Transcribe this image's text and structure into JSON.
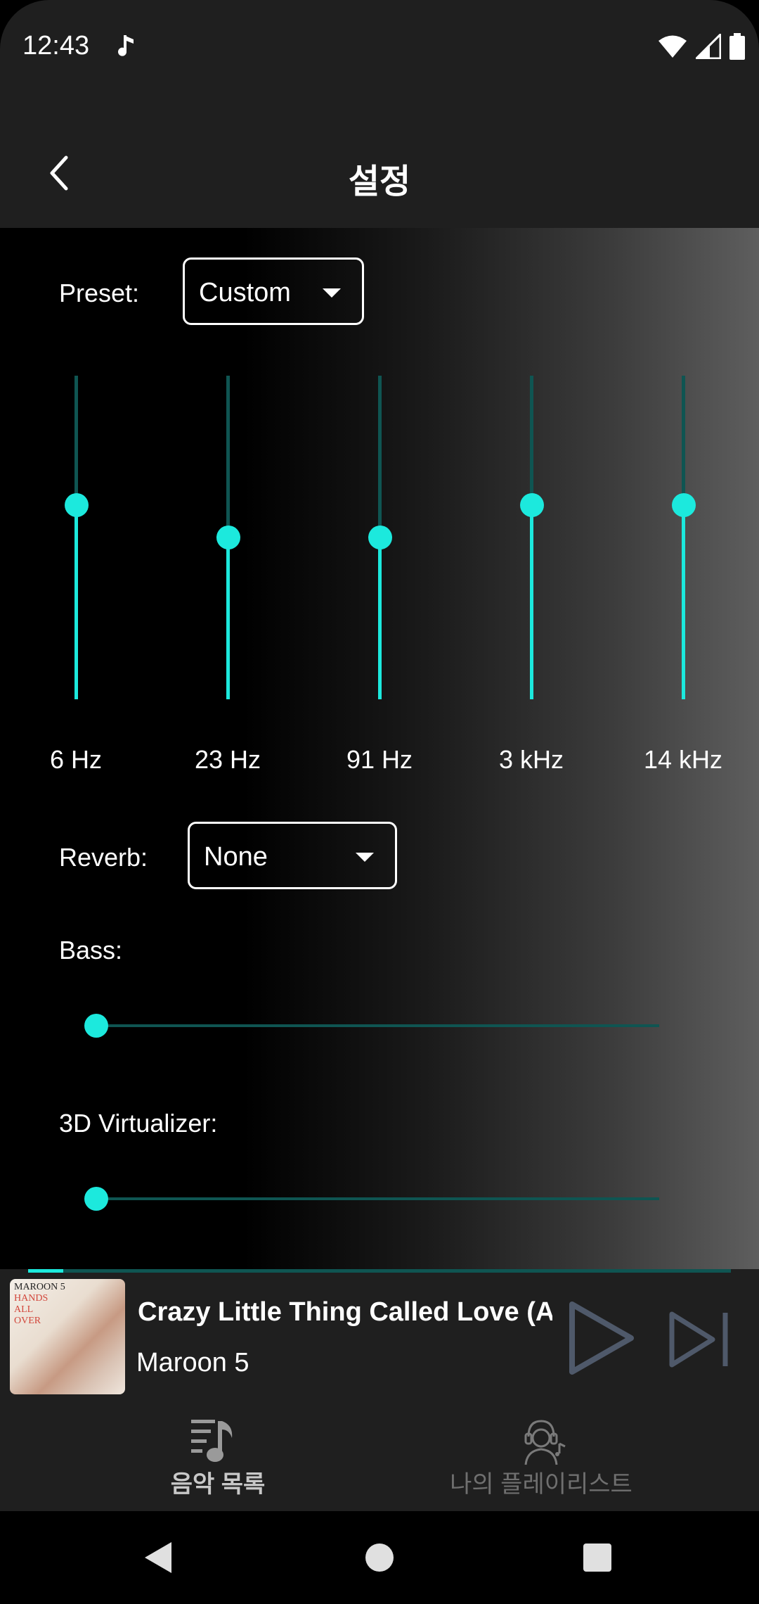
{
  "status_bar": {
    "time": "12:43",
    "notification_icon": "music-note-icon",
    "icons": [
      "wifi-icon",
      "signal-icon",
      "battery-icon"
    ]
  },
  "app_bar": {
    "title": "설정",
    "back_icon": "chevron-left-icon"
  },
  "equalizer": {
    "preset_label": "Preset:",
    "preset_value": "Custom",
    "bands": [
      {
        "label": "6 Hz",
        "level": 0.6
      },
      {
        "label": "23 Hz",
        "level": 0.5
      },
      {
        "label": "91 Hz",
        "level": 0.5
      },
      {
        "label": "3 kHz",
        "level": 0.6
      },
      {
        "label": "14 kHz",
        "level": 0.6
      }
    ],
    "reverb_label": "Reverb:",
    "reverb_value": "None",
    "bass_label": "Bass:",
    "bass_level": 0,
    "virtualizer_label": "3D Virtualizer:",
    "virtualizer_level": 0
  },
  "player": {
    "title": "Crazy Little Thing Called Love (A..",
    "artist": "Maroon 5",
    "progress": 0.05,
    "album_art_text": {
      "band": "MAROON 5",
      "line1": "HANDS",
      "line2": "ALL",
      "line3": "OVER"
    },
    "play_icon": "play-icon",
    "next_icon": "skip-next-icon"
  },
  "bottom_nav": {
    "tabs": [
      {
        "label": "음악 목록",
        "icon": "music-list-icon",
        "active": true
      },
      {
        "label": "나의 플레이리스트",
        "icon": "headphones-user-icon",
        "active": false
      }
    ]
  },
  "colors": {
    "accent": "#1ce9dd",
    "track": "#0f5552",
    "surface": "#1f1f1f",
    "inactive_icon": "#4f596a"
  }
}
